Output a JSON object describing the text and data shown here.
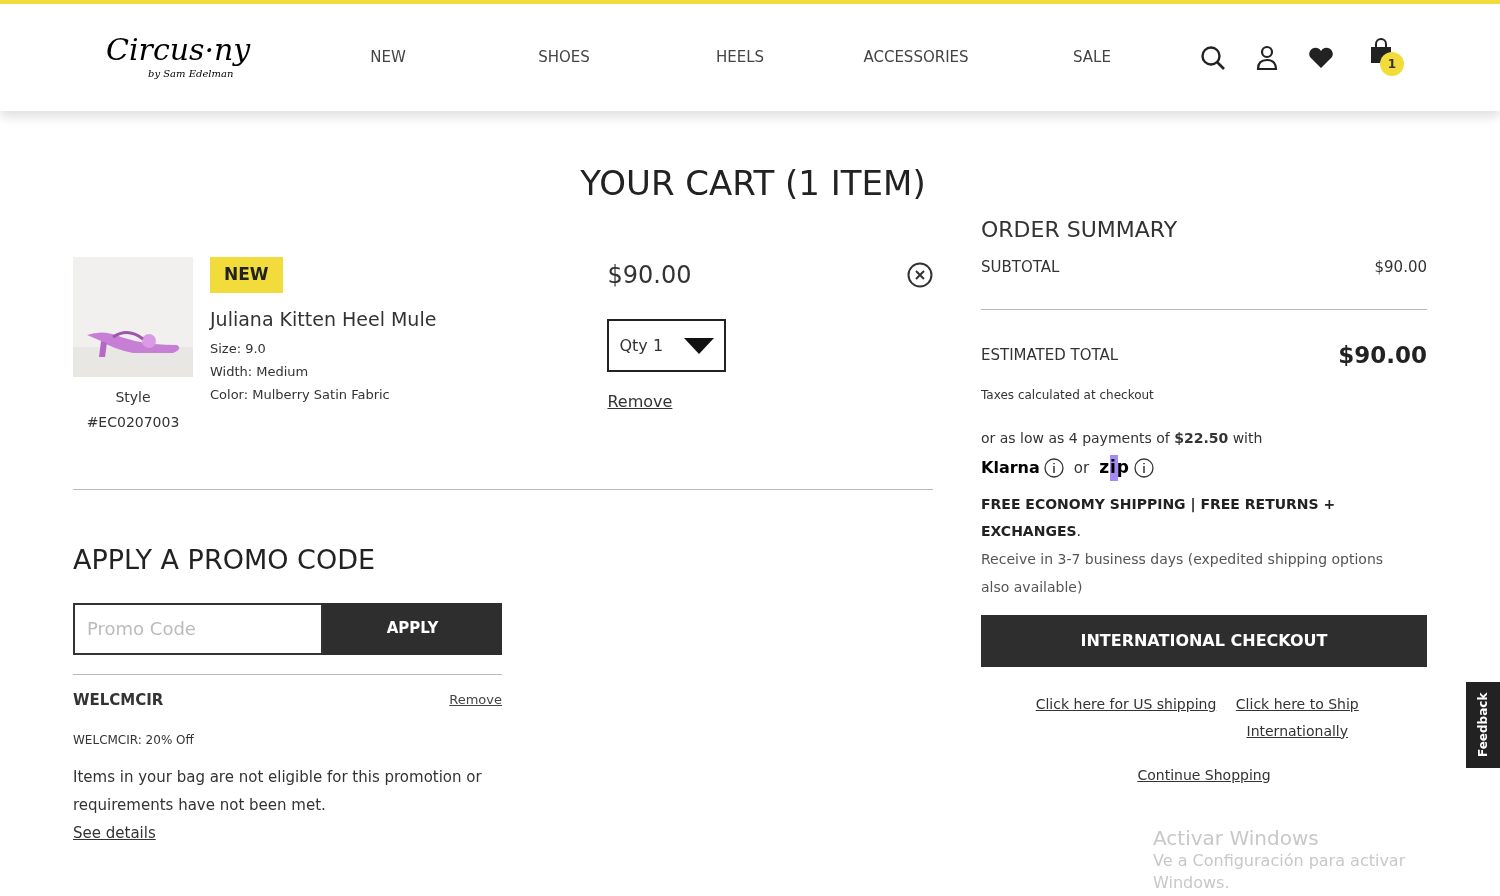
{
  "header": {
    "logo": {
      "name": "Circus·ny",
      "byline": "by Sam Edelman"
    },
    "nav": [
      {
        "label": "NEW"
      },
      {
        "label": "SHOES"
      },
      {
        "label": "HEELS"
      },
      {
        "label": "ACCESSORIES"
      },
      {
        "label": "SALE"
      }
    ],
    "cart_count": "1"
  },
  "page_title": "YOUR CART (1 ITEM)",
  "cart_items": [
    {
      "badge": "NEW",
      "name": "Juliana Kitten Heel Mule",
      "details": [
        "Size: 9.0",
        "Width: Medium",
        "Color: Mulberry Satin Fabric"
      ],
      "style_label": "Style",
      "style_number": "#EC0207003",
      "price": "$90.00",
      "quantity": "Qty 1",
      "remove": "Remove"
    }
  ],
  "promo": {
    "title": "APPLY A PROMO CODE",
    "placeholder": "Promo Code",
    "button": "APPLY",
    "applied": {
      "code": "WELCMCIR",
      "remove": "Remove",
      "description": "WELCMCIR: 20% Off",
      "message": "Items in your bag are not eligible for this promotion or requirements have not been met.",
      "link": "See details"
    }
  },
  "order_summary": {
    "title": "ORDER SUMMARY",
    "subtotal_label": "SUBTOTAL",
    "subtotal": "$90.00",
    "total_label": "ESTIMATED TOTAL",
    "total": "$90.00",
    "tax_note": "Taxes calculated at checkout",
    "installments": "or as low as 4 payments of **$22.50** with",
    "klarna": "Klarna",
    "or": "or",
    "zip": "zip",
    "shipping_heading": "FREE ECONOMY SHIPPING | FREE RETURNS + EXCHANGES",
    "shipping_period": ".",
    "shipping_note": "Receive in 3-7 business days (expedited shipping options also available)",
    "checkout_button": "INTERNATIONAL CHECKOUT",
    "us_link": "Click here for US shipping",
    "intl_link": "Click here to Ship Internationally",
    "continue": "Continue Shopping"
  },
  "feedback_tab": "Feedback",
  "os_overlay": {
    "title": "Activar Windows",
    "message": "Ve a Configuración para activar Windows."
  }
}
